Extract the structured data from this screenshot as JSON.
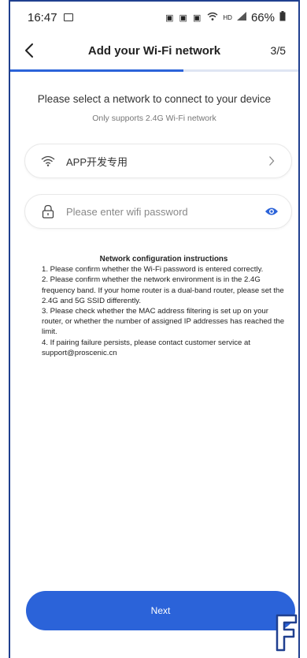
{
  "status_bar": {
    "time": "16:47",
    "network_label": "HD",
    "battery": "66%"
  },
  "header": {
    "title": "Add your Wi-Fi network",
    "step": "3/5",
    "progress": 0.6
  },
  "prompt": {
    "title": "Please select a network to connect to your device",
    "subtitle": "Only supports 2.4G Wi-Fi network"
  },
  "network_field": {
    "ssid": "APP开发专用"
  },
  "password_field": {
    "placeholder": "Please enter wifi password"
  },
  "instructions": {
    "title": "Network configuration instructions",
    "items": [
      "1. Please confirm whether the Wi-Fi password is entered correctly.",
      "2. Please confirm whether the network environment is in the 2.4G frequency band. If your home router is a dual-band router, please set the 2.4G and 5G SSID differently.",
      "3. Please check whether the MAC address filtering is set up on your router, or whether the number of assigned IP addresses has reached the limit.",
      "4. If pairing failure persists, please contact customer service at support@proscenic.cn"
    ]
  },
  "next_button": {
    "label": "Next"
  },
  "colors": {
    "accent": "#2b63d9",
    "frame": "#1f3f8f"
  }
}
